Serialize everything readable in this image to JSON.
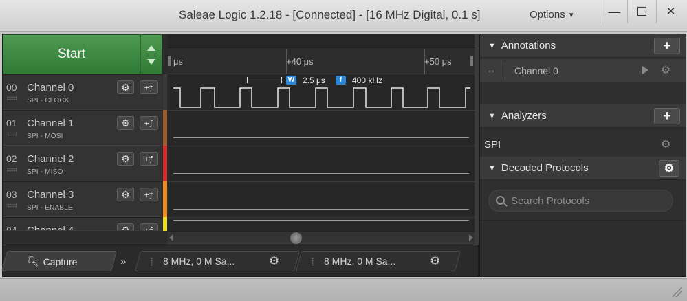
{
  "window": {
    "title": "Saleae Logic 1.2.18 - [Connected] - [16 MHz Digital, 0.1 s]",
    "options_label": "Options",
    "minimize": "—",
    "maximize": "☐",
    "close": "✕"
  },
  "capture": {
    "start_label": "Start"
  },
  "channels": [
    {
      "num": "00",
      "name": "Channel 0",
      "sub": "SPI - CLOCK",
      "color": "#3a3a3a"
    },
    {
      "num": "01",
      "name": "Channel 1",
      "sub": "SPI - MOSI",
      "color": "#9b5a2a"
    },
    {
      "num": "02",
      "name": "Channel 2",
      "sub": "SPI - MISO",
      "color": "#d62828"
    },
    {
      "num": "03",
      "name": "Channel 3",
      "sub": "SPI - ENABLE",
      "color": "#f08a1c"
    },
    {
      "num": "04",
      "name": "Channel 4",
      "sub": "",
      "color": "#e9e02a"
    }
  ],
  "channel_buttons": {
    "gear": "⚙",
    "trigger": "+ƒ"
  },
  "ruler": {
    "ticks": [
      "μs",
      "+40 μs",
      "+50 μs"
    ]
  },
  "measurement": {
    "width_badge": "W",
    "width_value": "2.5 μs",
    "freq_badge": "f",
    "freq_value": "400 kHz"
  },
  "tabs": {
    "capture_label": "Capture",
    "more_label": "»",
    "sessions": [
      {
        "label": "8 MHz, 0 M Sa..."
      },
      {
        "label": "8 MHz, 0 M Sa..."
      }
    ]
  },
  "right_panel": {
    "annotations": {
      "title": "Annotations",
      "add": "+",
      "item": "Channel 0",
      "arrows": "↔"
    },
    "analyzers": {
      "title": "Analyzers",
      "add": "+",
      "item": "SPI"
    },
    "decoded": {
      "title": "Decoded Protocols",
      "gear": "⚙",
      "search_placeholder": "Search Protocols"
    }
  },
  "icons": {
    "gear": "gear-icon",
    "add": "plus-icon",
    "search": "search-icon",
    "play": "play-icon"
  },
  "colors": {
    "start_green": "#3a8a40",
    "badge_blue": "#2e86d3"
  }
}
